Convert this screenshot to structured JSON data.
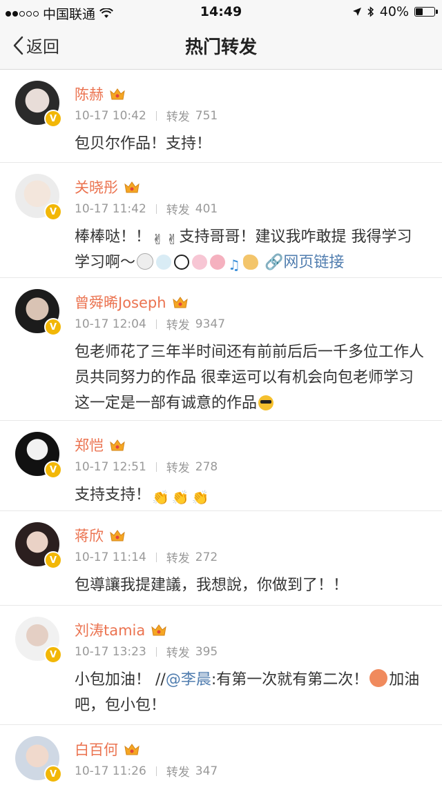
{
  "status_bar": {
    "carrier": "中国联通",
    "time": "14:49",
    "battery": "40%",
    "battery_level": 0.4
  },
  "nav": {
    "back_label": "返回",
    "title": "热门转发"
  },
  "accent_colors": {
    "name": "#eb7350",
    "link": "#507daf",
    "verified": "#f2b707"
  },
  "posts": [
    {
      "name": "陈赫",
      "time": "10-17 10:42",
      "repost_label": "转发",
      "repost_count": "751",
      "text": "包贝尔作品！支持！"
    },
    {
      "name": "关晓彤",
      "time": "10-17 11:42",
      "repost_label": "转发",
      "repost_count": "401",
      "text_a": "棒棒哒！！",
      "text_b": "支持哥哥！建议我咋敢提 我得学习学习啊～",
      "link": "网页链接"
    },
    {
      "name": "曾舜晞Joseph",
      "time": "10-17 12:04",
      "repost_label": "转发",
      "repost_count": "9347",
      "text": "包老师花了三年半时间还有前前后后一千多位工作人员共同努力的作品 很幸运可以有机会向包老师学习 这一定是一部有诚意的作品"
    },
    {
      "name": "郑恺",
      "time": "10-17 12:51",
      "repost_label": "转发",
      "repost_count": "278",
      "text": "支持支持！"
    },
    {
      "name": "蒋欣",
      "time": "10-17 11:14",
      "repost_label": "转发",
      "repost_count": "272",
      "text": "包導讓我提建議，我想說，你做到了！！"
    },
    {
      "name": "刘涛tamia",
      "time": "10-17 13:23",
      "repost_label": "转发",
      "repost_count": "395",
      "text_a": "小包加油！ //",
      "mention": "@李晨",
      "text_b": ":有第一次就有第二次！",
      "text_c": "加油吧，包小包！"
    },
    {
      "name": "白百何",
      "time": "10-17 11:26",
      "repost_label": "转发",
      "repost_count": "347"
    }
  ]
}
